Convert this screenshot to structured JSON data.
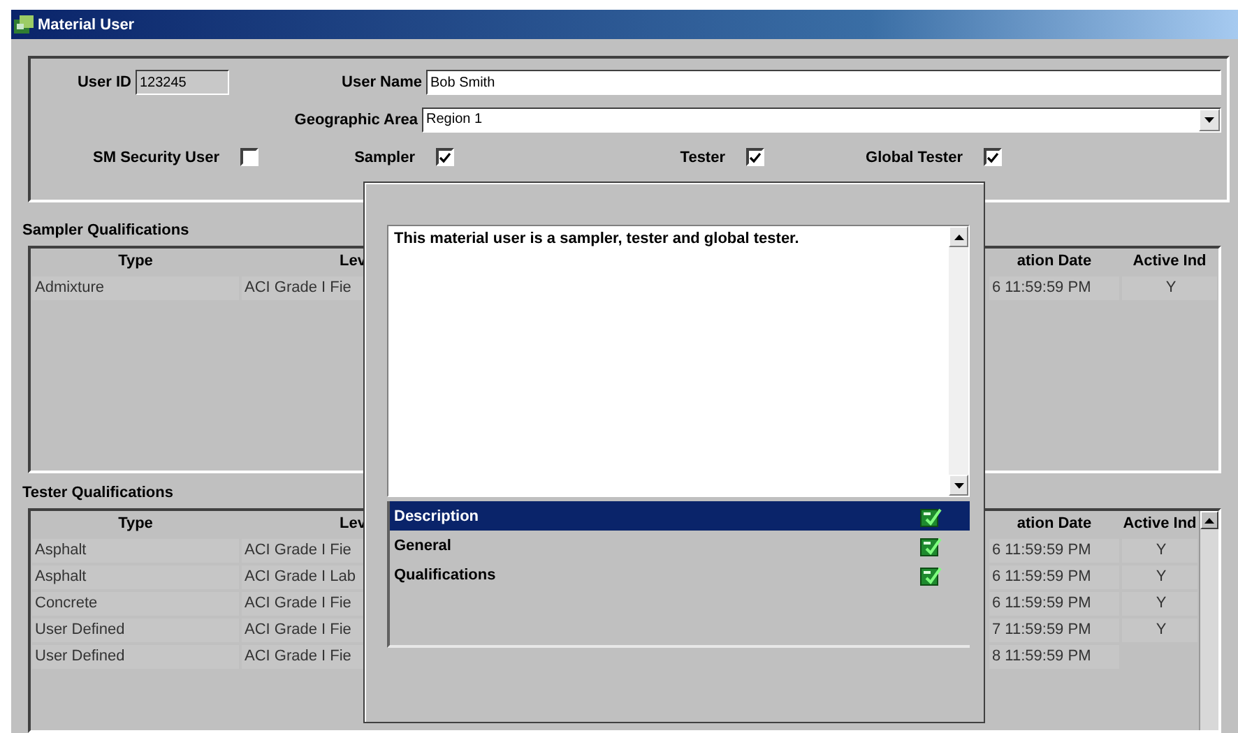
{
  "window": {
    "title": "Material User"
  },
  "form": {
    "user_id": {
      "label": "User ID",
      "value": "123245",
      "read_only": true
    },
    "user_name": {
      "label": "User Name",
      "value": "Bob Smith",
      "read_only": false
    },
    "geographic_area": {
      "label": "Geographic Area",
      "value": "Region 1"
    },
    "checkboxes": [
      {
        "label": "SM Security User",
        "checked": false
      },
      {
        "label": "Sampler",
        "checked": true
      },
      {
        "label": "Tester",
        "checked": true
      },
      {
        "label": "Global Tester",
        "checked": true
      }
    ]
  },
  "sampler_qualifications": {
    "title": "Sampler Qualifications",
    "columns": [
      "Type",
      "Lev",
      "ation Date",
      "Active Ind"
    ],
    "rows": [
      {
        "type": "Admixture",
        "level": "ACI Grade I Fie",
        "date": "6 11:59:59 PM",
        "active": "Y"
      }
    ]
  },
  "tester_qualifications": {
    "title": "Tester Qualifications",
    "columns": [
      "Type",
      "Lev",
      "ation Date",
      "Active Ind"
    ],
    "rows": [
      {
        "type": "Asphalt",
        "level": "ACI Grade I Fie",
        "date": "6 11:59:59 PM",
        "active": "Y"
      },
      {
        "type": "Asphalt",
        "level": "ACI Grade I Lab",
        "date": "6 11:59:59 PM",
        "active": "Y"
      },
      {
        "type": "Concrete",
        "level": "ACI Grade I Fie",
        "date": "6 11:59:59 PM",
        "active": "Y"
      },
      {
        "type": "User Defined",
        "level": "ACI Grade I Fie",
        "date": "7 11:59:59 PM",
        "active": "Y"
      },
      {
        "type": "User Defined",
        "level": "ACI Grade I Fie",
        "date": "8 11:59:59 PM"
      }
    ]
  },
  "popup": {
    "description": "This material user is a sampler, tester and global tester.",
    "sections": [
      {
        "label": "Description",
        "selected": true
      },
      {
        "label": "General",
        "selected": false
      },
      {
        "label": "Qualifications",
        "selected": false
      }
    ]
  }
}
